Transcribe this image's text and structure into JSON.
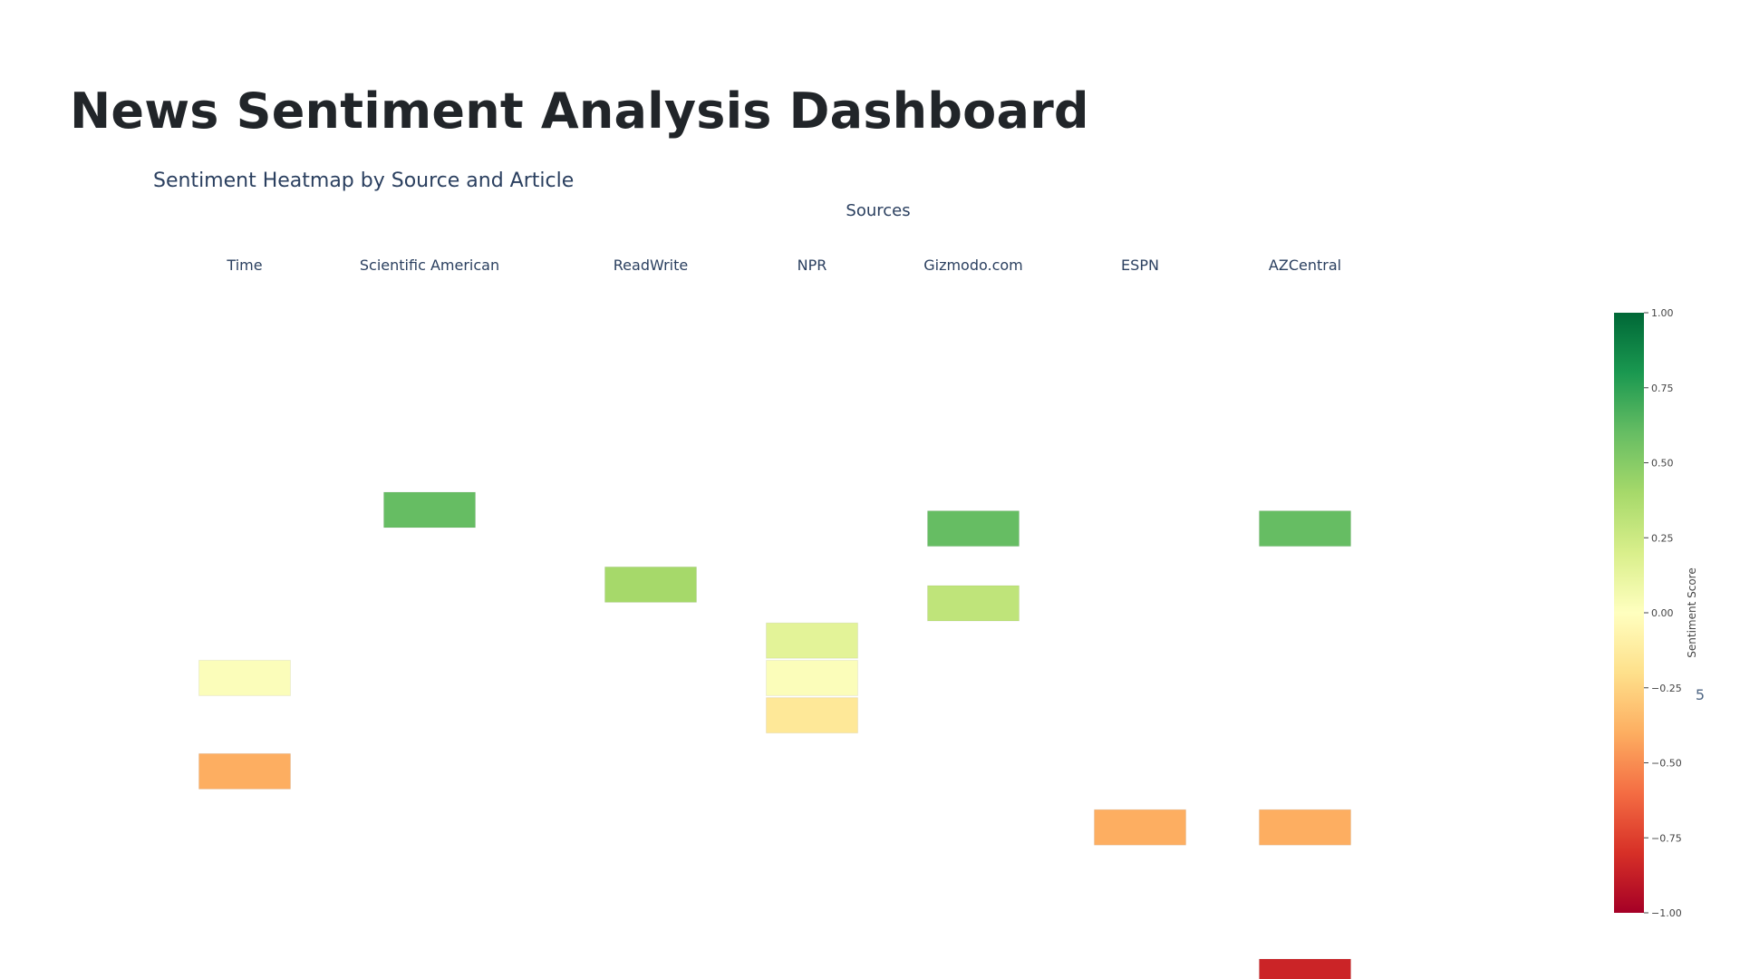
{
  "page": {
    "title": "News Sentiment Analysis Dashboard"
  },
  "chart_data": {
    "type": "heatmap",
    "title": "Sentiment Heatmap by Source and Article",
    "xlabel": "Sources",
    "ylabel": "",
    "side_marker": "5",
    "x_categories": [
      "Time",
      "Scientific American",
      "ReadWrite",
      "NPR",
      "Gizmodo.com",
      "ESPN",
      "AZCentral"
    ],
    "cells": [
      {
        "source": "Scientific American",
        "row": 5,
        "value": 0.6
      },
      {
        "source": "Gizmodo.com",
        "row": 6,
        "value": 0.6
      },
      {
        "source": "AZCentral",
        "row": 6,
        "value": 0.6
      },
      {
        "source": "ReadWrite",
        "row": 9,
        "value": 0.4
      },
      {
        "source": "Gizmodo.com",
        "row": 10,
        "value": 0.3
      },
      {
        "source": "NPR",
        "row": 12,
        "value": 0.15
      },
      {
        "source": "Time",
        "row": 14,
        "value": 0.02
      },
      {
        "source": "NPR",
        "row": 14,
        "value": 0.02
      },
      {
        "source": "NPR",
        "row": 16,
        "value": -0.15
      },
      {
        "source": "Time",
        "row": 19,
        "value": -0.4
      },
      {
        "source": "ESPN",
        "row": 22,
        "value": -0.4
      },
      {
        "source": "AZCentral",
        "row": 22,
        "value": -0.4
      },
      {
        "source": "AZCentral",
        "row": 30,
        "value": -0.85
      }
    ],
    "colorbar": {
      "title": "Sentiment Score",
      "range": [
        -1,
        1
      ],
      "ticks": [
        "1.00",
        "0.75",
        "0.50",
        "0.25",
        "0.00",
        "−0.25",
        "−0.50",
        "−0.75",
        "−1.00"
      ],
      "colorscale": "RdYlGn"
    },
    "grid": false,
    "xaxis_position": "top"
  }
}
